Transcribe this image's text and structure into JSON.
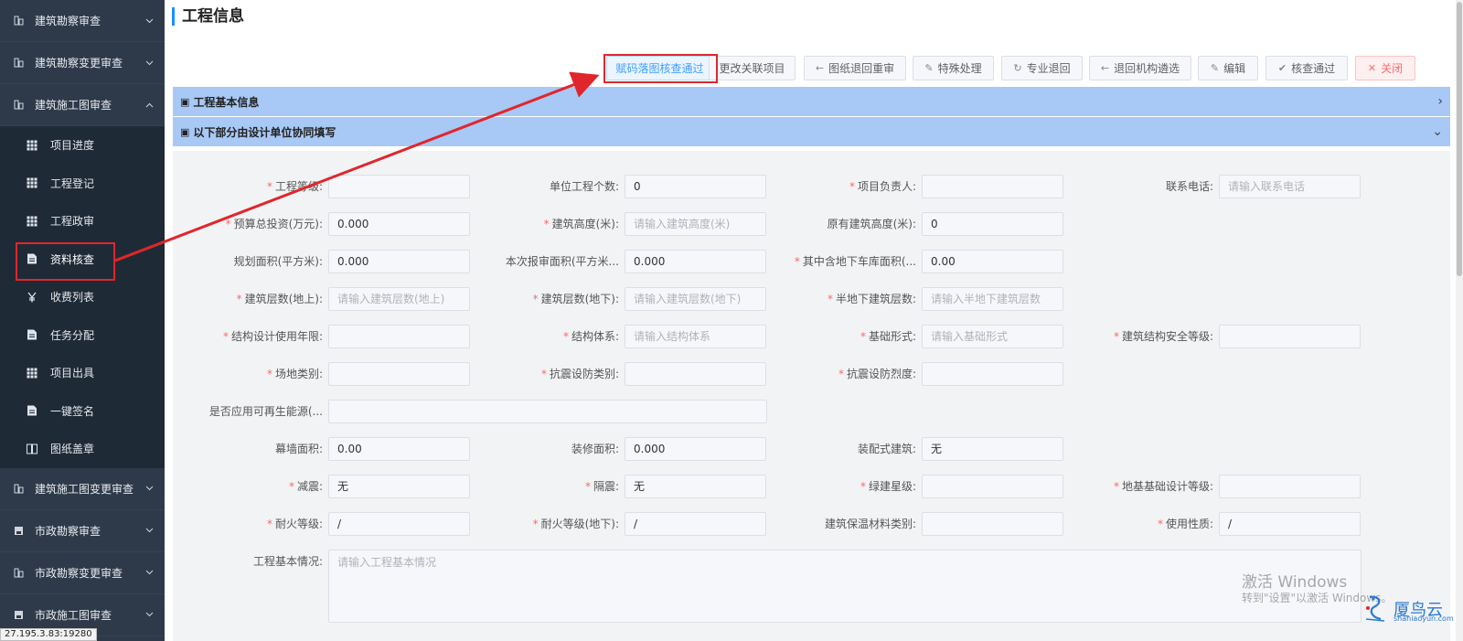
{
  "sidebar": {
    "groups_top": [
      {
        "label": "建筑勘察审查",
        "icon": "grid-icon",
        "open": false
      },
      {
        "label": "建筑勘察变更审查",
        "icon": "grid-icon",
        "open": false
      },
      {
        "label": "建筑施工图审查",
        "icon": "grid-icon",
        "open": true
      }
    ],
    "sub_items": [
      {
        "label": "项目进度",
        "icon": "table-icon"
      },
      {
        "label": "工程登记",
        "icon": "table-icon"
      },
      {
        "label": "工程政审",
        "icon": "table-icon"
      },
      {
        "label": "资料核查",
        "icon": "document-icon"
      },
      {
        "label": "收费列表",
        "icon": "yen-icon"
      },
      {
        "label": "任务分配",
        "icon": "document-icon"
      },
      {
        "label": "项目出具",
        "icon": "table-icon"
      },
      {
        "label": "一键签名",
        "icon": "document-icon"
      },
      {
        "label": "图纸盖章",
        "icon": "book-icon"
      }
    ],
    "groups_bottom": [
      {
        "label": "建筑施工图变更审查",
        "icon": "grid-icon"
      },
      {
        "label": "市政勘察审查",
        "icon": "save-icon"
      },
      {
        "label": "市政勘察变更审查",
        "icon": "grid-icon"
      },
      {
        "label": "市政施工图审查",
        "icon": "save-icon"
      }
    ],
    "url_tip": "27.195.3.83:19280"
  },
  "page": {
    "title": "工程信息"
  },
  "toolbar": [
    {
      "label": "赋码落图核查通过",
      "icon": "",
      "style": "primary"
    },
    {
      "label": "更改关联项目",
      "icon": "",
      "style": "default"
    },
    {
      "label": "图纸退回重审",
      "icon": "←",
      "style": "default"
    },
    {
      "label": "特殊处理",
      "icon": "✎",
      "style": "default"
    },
    {
      "label": "专业退回",
      "icon": "↻",
      "style": "default"
    },
    {
      "label": "退回机构遴选",
      "icon": "←",
      "style": "default"
    },
    {
      "label": "编辑",
      "icon": "✎",
      "style": "default"
    },
    {
      "label": "核查通过",
      "icon": "✔",
      "style": "default"
    },
    {
      "label": "关闭",
      "icon": "✕",
      "style": "danger"
    }
  ],
  "panels": {
    "basic": {
      "label": "工程基本信息",
      "icon": "▣",
      "chevron": "›"
    },
    "design": {
      "label": "以下部分由设计单位协同填写",
      "icon": "▣",
      "chevron": "⌄"
    }
  },
  "form": {
    "rows": [
      [
        {
          "label": "工程等级:",
          "required": true,
          "value": "",
          "placeholder": ""
        },
        {
          "label": "单位工程个数:",
          "required": false,
          "value": "0",
          "placeholder": ""
        },
        {
          "label": "项目负责人:",
          "required": true,
          "value": "",
          "placeholder": ""
        },
        {
          "label": "联系电话:",
          "required": false,
          "value": "",
          "placeholder": "请输入联系电话"
        }
      ],
      [
        {
          "label": "预算总投资(万元):",
          "required": true,
          "value": "0.000",
          "placeholder": ""
        },
        {
          "label": "建筑高度(米):",
          "required": true,
          "value": "",
          "placeholder": "请输入建筑高度(米)"
        },
        {
          "label": "原有建筑高度(米):",
          "required": false,
          "value": "0",
          "placeholder": ""
        }
      ],
      [
        {
          "label": "规划面积(平方米):",
          "required": false,
          "value": "0.000",
          "placeholder": ""
        },
        {
          "label": "本次报审面积(平方米...",
          "required": false,
          "value": "0.000",
          "placeholder": ""
        },
        {
          "label": "其中含地下车库面积(...",
          "required": true,
          "value": "0.00",
          "placeholder": ""
        }
      ],
      [
        {
          "label": "建筑层数(地上):",
          "required": true,
          "value": "",
          "placeholder": "请输入建筑层数(地上)"
        },
        {
          "label": "建筑层数(地下):",
          "required": true,
          "value": "",
          "placeholder": "请输入建筑层数(地下)"
        },
        {
          "label": "半地下建筑层数:",
          "required": true,
          "value": "",
          "placeholder": "请输入半地下建筑层数"
        }
      ],
      [
        {
          "label": "结构设计使用年限:",
          "required": true,
          "value": "",
          "placeholder": ""
        },
        {
          "label": "结构体系:",
          "required": true,
          "value": "",
          "placeholder": "请输入结构体系"
        },
        {
          "label": "基础形式:",
          "required": true,
          "value": "",
          "placeholder": "请输入基础形式"
        },
        {
          "label": "建筑结构安全等级:",
          "required": true,
          "value": "",
          "placeholder": ""
        }
      ],
      [
        {
          "label": "场地类别:",
          "required": true,
          "value": "",
          "placeholder": ""
        },
        {
          "label": "抗震设防类别:",
          "required": true,
          "value": "",
          "placeholder": ""
        },
        {
          "label": "抗震设防烈度:",
          "required": true,
          "value": "",
          "placeholder": ""
        }
      ],
      [
        {
          "label": "是否应用可再生能源(...",
          "required": false,
          "value": "",
          "placeholder": "",
          "wide": true
        }
      ],
      [
        {
          "label": "幕墙面积:",
          "required": false,
          "value": "0.00",
          "placeholder": ""
        },
        {
          "label": "装修面积:",
          "required": false,
          "value": "0.000",
          "placeholder": ""
        },
        {
          "label": "装配式建筑:",
          "required": false,
          "value": "无",
          "placeholder": ""
        }
      ],
      [
        {
          "label": "减震:",
          "required": true,
          "value": "无",
          "placeholder": ""
        },
        {
          "label": "隔震:",
          "required": true,
          "value": "无",
          "placeholder": ""
        },
        {
          "label": "绿建星级:",
          "required": true,
          "value": "",
          "placeholder": ""
        },
        {
          "label": "地基基础设计等级:",
          "required": true,
          "value": "",
          "placeholder": ""
        }
      ],
      [
        {
          "label": "耐火等级:",
          "required": true,
          "value": "/",
          "placeholder": ""
        },
        {
          "label": "耐火等级(地下):",
          "required": true,
          "value": "/",
          "placeholder": ""
        },
        {
          "label": "建筑保温材料类别:",
          "required": false,
          "value": "",
          "placeholder": ""
        },
        {
          "label": "使用性质:",
          "required": true,
          "value": "/",
          "placeholder": ""
        }
      ]
    ],
    "textarea": {
      "label": "工程基本情况:",
      "required": false,
      "placeholder": "请输入工程基本情况"
    }
  },
  "overlay": {
    "watermark_line1": "激活 Windows",
    "watermark_line2": "转到\"设置\"以激活 Windows。",
    "logo_text": "厦鸟云",
    "logo_sub": "shaniaoyun.com"
  },
  "colors": {
    "sidebar_bg": "#2e3a4a",
    "submenu_bg": "#1f2a37",
    "panel_bar": "#a8c8f5",
    "accent": "#1890ff",
    "highlight_red": "#e0262b"
  }
}
